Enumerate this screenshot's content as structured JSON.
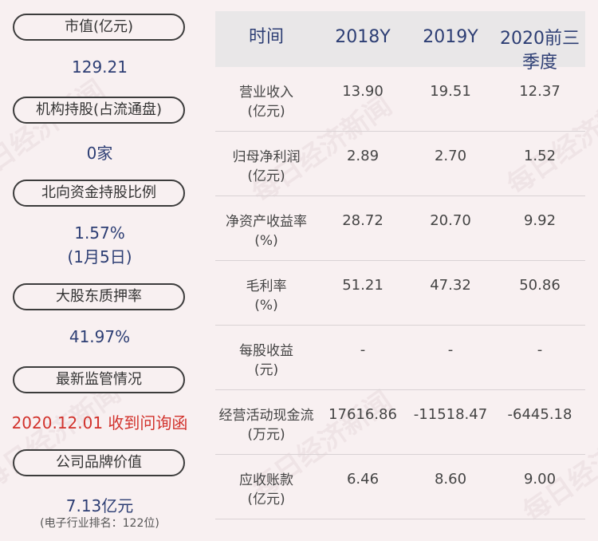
{
  "left": {
    "items": [
      {
        "label": "市值(亿元)",
        "value": "129.21"
      },
      {
        "label": "机构持股(占流通盘)",
        "value": "0家"
      },
      {
        "label": "北向资金持股比例",
        "value": "1.57%",
        "value2": "(1月5日)"
      },
      {
        "label": "大股东质押率",
        "value": "41.97%"
      },
      {
        "label": "最新监管情况",
        "value": "2020.12.01 收到问询函"
      },
      {
        "label": "公司品牌价值",
        "value": "7.13亿元",
        "note": "(电子行业排名：122位)"
      }
    ]
  },
  "table": {
    "headers": [
      "时间",
      "2018Y",
      "2019Y",
      "2020前三",
      "季度"
    ],
    "rows": [
      {
        "label1": "营业收入",
        "label2": "(亿元)",
        "v": [
          "13.90",
          "19.51",
          "12.37"
        ]
      },
      {
        "label1": "归母净利润",
        "label2": "(亿元)",
        "v": [
          "2.89",
          "2.70",
          "1.52"
        ]
      },
      {
        "label1": "净资产收益率",
        "label2": "(%)",
        "v": [
          "28.72",
          "20.70",
          "9.92"
        ]
      },
      {
        "label1": "毛利率",
        "label2": "(%)",
        "v": [
          "51.21",
          "47.32",
          "50.86"
        ]
      },
      {
        "label1": "每股收益",
        "label2": "(元)",
        "v": [
          "-",
          "-",
          "-"
        ]
      },
      {
        "label1": "经营活动现金流",
        "label2": "(万元)",
        "v": [
          "17616.86",
          "-11518.47",
          "-6445.18"
        ]
      },
      {
        "label1": "应收账款",
        "label2": "(亿元)",
        "v": [
          "6.46",
          "8.60",
          "9.00"
        ]
      }
    ]
  },
  "watermark": "每日经济新闻"
}
